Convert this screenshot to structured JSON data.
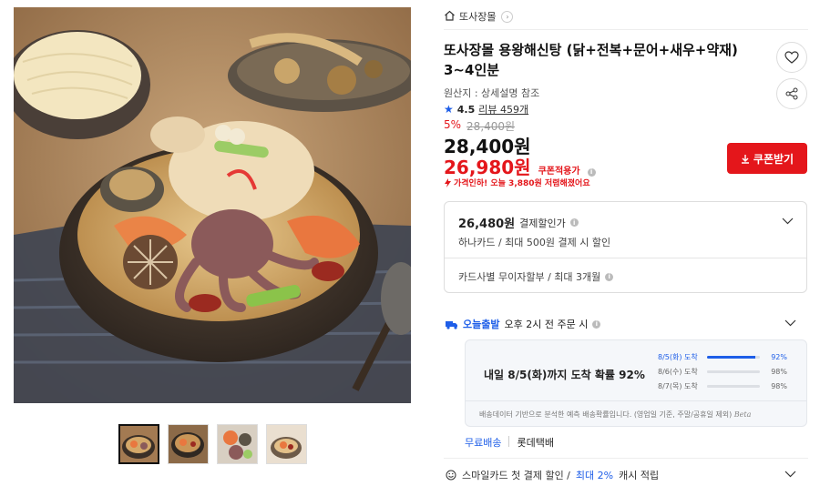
{
  "store": {
    "name": "또사장몰",
    "home_icon": "home-icon",
    "chevron": "›"
  },
  "product": {
    "title": "또사장몰 용왕해신탕 (닭+전복+문어+새우+약재) 3~4인분",
    "origin": "원산지 : 상세설명 참조",
    "rating": {
      "star": "★",
      "score": "4.5",
      "reviews": "리뷰 459개"
    },
    "discount_pct": "5%",
    "original_price": "28,400원",
    "price": "28,400원",
    "coupon_price": "26,980원",
    "coupon_tag": "쿠폰적용가",
    "price_drop": "가격인하! 오늘 3,880원 저렴해졌어요",
    "coupon_button": "쿠폰받기"
  },
  "card_offer": {
    "amount": "26,480원",
    "label": "결제할인가",
    "detail": "하나카드 / 최대 500원 결제 시 할인",
    "installment": "카드사별 무이자할부 / 최대 3개월"
  },
  "shipping": {
    "badge": "오늘출발",
    "cutoff": "오후 2시 전 주문 시",
    "headline": "내일 8/5(화)까지 도착 확률 92%",
    "rows": [
      {
        "date": "8/5(화) 도착",
        "pct": "92%",
        "value": 0.92
      },
      {
        "date": "8/6(수) 도착",
        "pct": "98%",
        "value": 0.98
      },
      {
        "date": "8/7(목) 도착",
        "pct": "98%",
        "value": 0.98
      }
    ],
    "note": "배송데이터 기반으로 분석한 예측 배송확률입니다. (영업일 기준, 주말/공휴일 제외)",
    "beta": "Beta",
    "free": "무료배송",
    "courier": "롯데택배"
  },
  "smile": {
    "text1": "스마일카드 첫 결제 할인 /",
    "text2": "최대 2%",
    "text3": "캐시 적립"
  },
  "colors": {
    "accent_red": "#e4161b",
    "accent_blue": "#1e5ee8"
  }
}
